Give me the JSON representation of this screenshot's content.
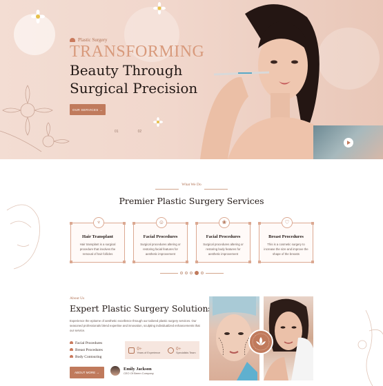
{
  "hero": {
    "kicker": "Plastic Surgery",
    "title_line1": "TRANSFORMING",
    "title_line2": "Beauty Through",
    "title_line3": "Surgical Precision",
    "button_label": "OUR SERVICES",
    "button_arrow": "→",
    "slide_prev": "01",
    "slide_next": "02"
  },
  "services": {
    "kicker": "What We Do",
    "title": "Premier Plastic Surgery Services",
    "cards": [
      {
        "title": "Hair Transplant",
        "desc": "Hair transplant is a surgical procedure that involves the removal of hair follicles",
        "icon": "hair-icon"
      },
      {
        "title": "Facial Procedures",
        "desc": "Surgical procedures altering or restoring facial features for aesthetic improvement",
        "icon": "face-icon"
      },
      {
        "title": "Facial Procedures",
        "desc": "Surgical procedures altering or restoring body features for aesthetic improvement",
        "icon": "lotus-icon"
      },
      {
        "title": "Breast Procedures",
        "desc": "This is a cosmetic surgery to increase the size and improve the shape of the breasts",
        "icon": "breast-icon"
      }
    ]
  },
  "about": {
    "kicker": "About Us",
    "title": "Expert Plastic Surgery Solutions",
    "description": "Experience the epitome of aesthetic excellence through our tailored plastic surgery services. Our seasoned professionals blend expertise and innovation, sculpting individualized enhancements that our service.",
    "bullets": [
      "Facial Procedures",
      "Breast Procedures",
      "Body Contouring"
    ],
    "stats": [
      {
        "number": "0+",
        "label": "Years of Experience"
      },
      {
        "number": "0+",
        "label": "Specialists Team"
      }
    ],
    "button_label": "ABOUT MORE",
    "button_arrow": "→",
    "author_name": "Emily Jackson",
    "author_role": "CEO Of Beem Company"
  },
  "colors": {
    "accent": "#c07a5c",
    "accent_light": "#d89a7c",
    "hero_bg": "#f1d7cc",
    "heading": "#221815"
  }
}
